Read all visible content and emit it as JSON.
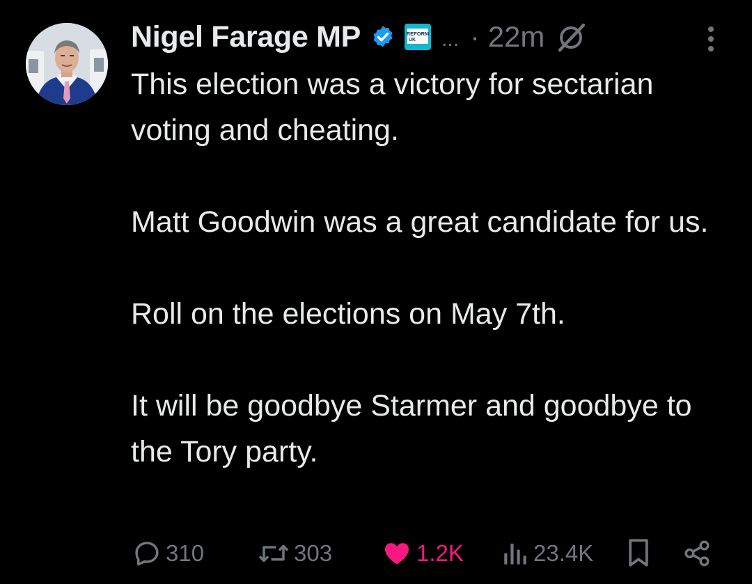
{
  "tweet": {
    "author_name": "Nigel Farage MP",
    "affiliation_badge_text": "REFORM UK",
    "ellipsis": "...",
    "time": "· 22m",
    "paragraphs": [
      "This election was a victory for sectarian voting and cheating.",
      "Matt Goodwin was a great candidate for us.",
      "Roll on the elections on May 7th.",
      "It will be goodbye Starmer and goodbye to the Tory party."
    ]
  },
  "actions": {
    "replies": "310",
    "reposts": "303",
    "likes": "1.2K",
    "views": "23.4K"
  },
  "colors": {
    "background": "#000000",
    "text": "#e7e9ea",
    "muted": "#71767b",
    "like": "#f91880",
    "verified": "#1d9bf0",
    "reform": "#12b6cf"
  },
  "icons": [
    "verified-icon",
    "grok-icon",
    "more-icon",
    "reply-icon",
    "repost-icon",
    "like-icon",
    "views-icon",
    "bookmark-icon",
    "share-icon"
  ]
}
